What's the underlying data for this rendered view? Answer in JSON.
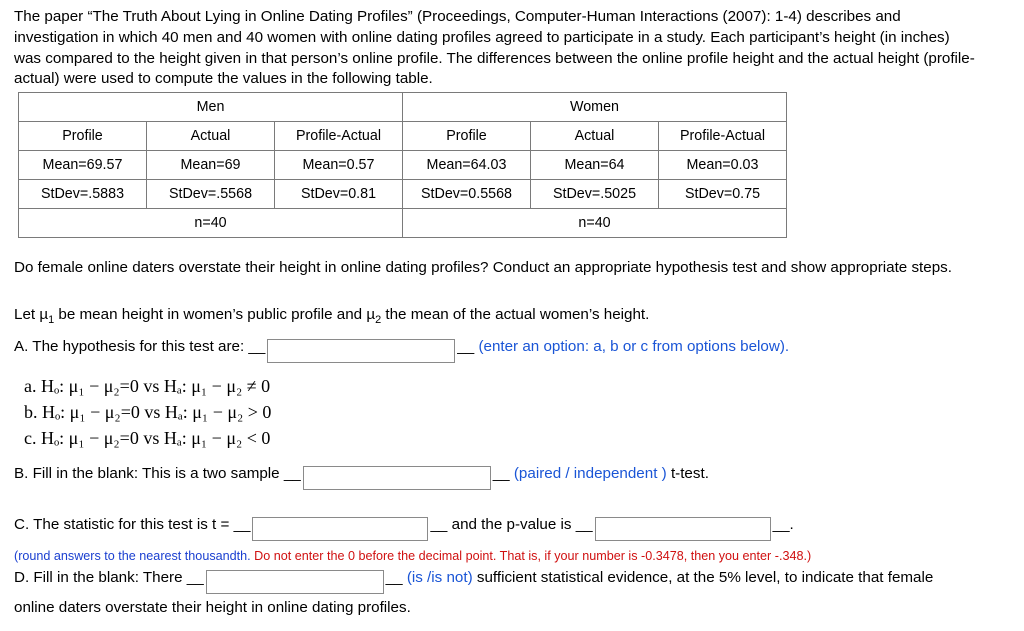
{
  "intro": "The paper “The Truth About Lying in Online Dating Profiles” (Proceedings, Computer-Human Interactions (2007): 1-4) describes and investigation in which 40 men and 40 women with online dating profiles agreed to participate in a study. Each participant’s height (in inches) was compared to the height given in that person’s online profile. The differences between the online profile height and the actual height (profile-actual) were used to compute the values in the following table.",
  "table": {
    "group_headers": [
      "Men",
      "Women"
    ],
    "column_headers": [
      "Profile",
      "Actual",
      "Profile-Actual",
      "Profile",
      "Actual",
      "Profile-Actual"
    ],
    "rows": [
      [
        "Mean=69.57",
        "Mean=69",
        "Mean=0.57",
        "Mean=64.03",
        "Mean=64",
        "Mean=0.03"
      ],
      [
        "StDev=.5883",
        "StDev=.5568",
        "StDev=0.81",
        "StDev=0.5568",
        "StDev=.5025",
        "StDev=0.75"
      ]
    ],
    "footer": [
      "n=40",
      "n=40"
    ]
  },
  "questions": {
    "prompt": "Do female online daters overstate their height in online dating profiles? Conduct an appropriate hypothesis test and show appropriate steps.",
    "let_pre": "Let ",
    "let_mu1": "µ",
    "let_mu1_sub": "1",
    "let_mid": " be mean height in women’s public profile and ",
    "let_mu2": "µ",
    "let_mu2_sub": "2",
    "let_post": " the mean of the actual women’s height.",
    "a_label": "A. The hypothesis for this test are: __",
    "a_suffix_dash": "__",
    "a_hint": "(enter an option: a, b or c from options below).",
    "a_value": "",
    "options": [
      "a. Hₒ: μ₁ − μ₂=0 vs Hₐ: μ₁ − μ₂ ≠ 0",
      "b. Hₒ: μ₁ − μ₂=0 vs Hₐ: μ₁ − μ₂ > 0",
      "c. Hₒ: μ₁ − μ₂=0 vs Hₐ: μ₁ − μ₂ < 0"
    ],
    "b_label": "B. Fill in the blank: This is a two sample __",
    "b_value": "",
    "b_mid_dash": "__",
    "b_choice": "(paired / independent )",
    "b_tail": "t-test.",
    "c_label": "C. The statistic for this test is t = __",
    "c_value1": "",
    "c_mid_dash": "__",
    "c_mid": "and the p-value is __",
    "c_value2": "",
    "c_tail": "__.",
    "note_black": "(round answers to the nearest thousandth. ",
    "note_red": "Do not enter the 0 before the decimal point. That is, if your number is -0.3478, then you enter -.348.)",
    "d_label": "D. Fill in the blank:  There __",
    "d_value": "",
    "d_mid_dash": "__",
    "d_choice": "(is /is not)",
    "d_tail": "sufficient statistical evidence, at the 5% level, to  indicate that female",
    "d_line2": "online daters overstate their height in online dating profiles."
  }
}
